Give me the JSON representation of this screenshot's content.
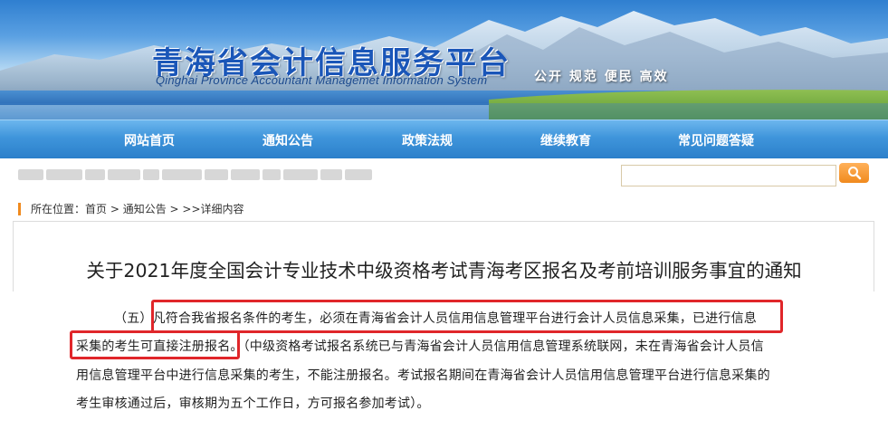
{
  "banner": {
    "title": "青海省会计信息服务平台",
    "subtitle": "Qinghai Province Accountant Managemet Information System",
    "slogan": "公开 规范 便民 高效"
  },
  "nav": {
    "items": [
      "网站首页",
      "通知公告",
      "政策法规",
      "继续教育",
      "常见问题答疑"
    ]
  },
  "search": {
    "placeholder": "",
    "icon": "search-icon",
    "button_color": "#f08a1e"
  },
  "breadcrumb": {
    "prefix": "所在位置：",
    "home": "首页",
    "section": "通知公告",
    "current": ">>详细内容"
  },
  "article": {
    "title": "关于2021年度全国会计专业技术中级资格考试青海考区报名及考前培训服务事宜的通知",
    "lines": [
      "（五）凡符合我省报名条件的考生，必须在青海省会计人员信用信息管理平台进行会计人员信息采集，已进行信息",
      "采集的考生可直接注册报名。（中级资格考试报名系统已与青海省会计人员信用信息管理系统联网，未在青海省会计人员信",
      "用信息管理平台中进行信息采集的考生，不能注册报名。考试报名期间在青海省会计人员信用信息管理平台进行信息采集的",
      "考生审核通过后，审核期为五个工作日，方可报名参加考试）。"
    ]
  },
  "colors": {
    "nav_blue": "#3f95db",
    "accent_orange": "#f08a1e",
    "highlight_red": "#e0262a"
  }
}
